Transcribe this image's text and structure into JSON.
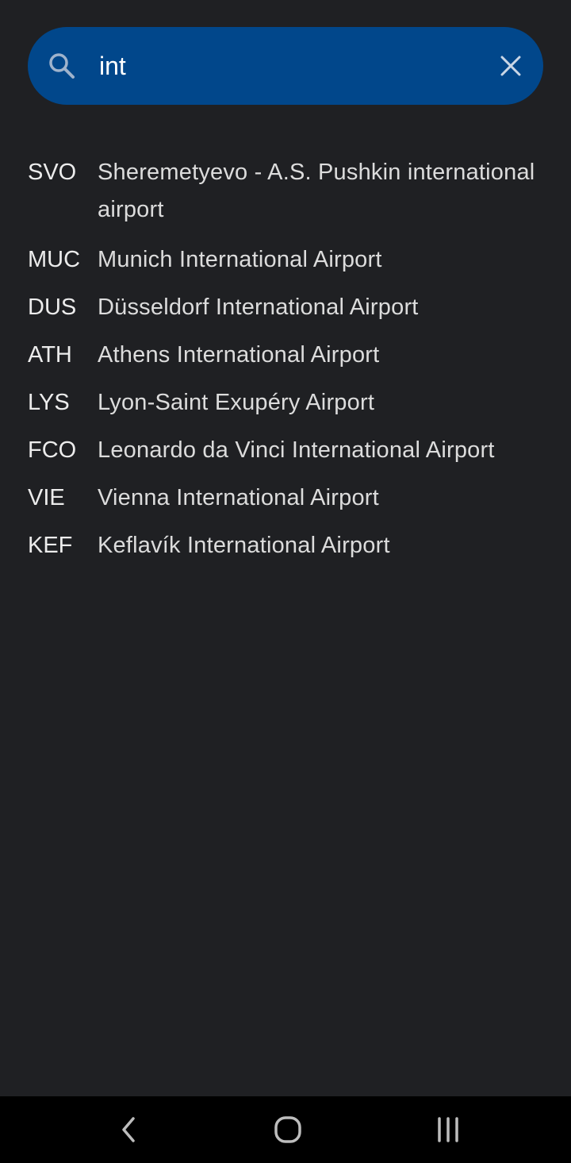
{
  "search": {
    "value": "int",
    "placeholder": ""
  },
  "icons": {
    "search": "search-icon",
    "clear": "close-icon",
    "nav_back": "chevron-left-icon",
    "nav_home": "home-icon",
    "nav_recents": "recents-icon"
  },
  "colors": {
    "background": "#1f2023",
    "search_bar": "#01478b",
    "nav_bar": "#000000",
    "text": "#dcdcdc"
  },
  "results": [
    {
      "code": "SVO",
      "name": "Sheremetyevo - A.S. Pushkin international airport"
    },
    {
      "code": "MUC",
      "name": "Munich International Airport"
    },
    {
      "code": "DUS",
      "name": "Düsseldorf International Airport"
    },
    {
      "code": "ATH",
      "name": "Athens International Airport"
    },
    {
      "code": "LYS",
      "name": "Lyon-Saint Exupéry Airport"
    },
    {
      "code": "FCO",
      "name": "Leonardo da Vinci International Airport"
    },
    {
      "code": "VIE",
      "name": "Vienna International Airport"
    },
    {
      "code": "KEF",
      "name": "Keflavík International Airport"
    }
  ]
}
